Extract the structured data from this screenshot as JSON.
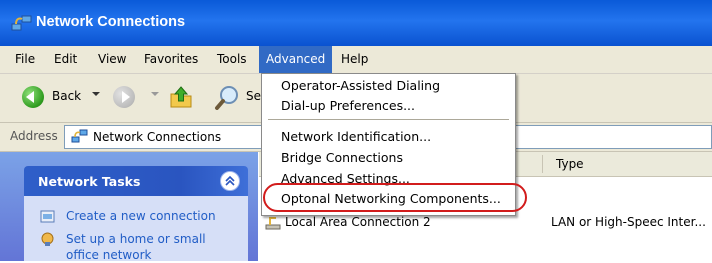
{
  "window": {
    "title": "Network Connections"
  },
  "menu": {
    "file": "File",
    "edit": "Edit",
    "view": "View",
    "favorites": "Favorites",
    "tools": "Tools",
    "advanced": "Advanced",
    "help": "Help"
  },
  "advanced_menu": {
    "items": [
      "Operator-Assisted Dialing",
      "Dial-up Preferences...",
      "Network Identification...",
      "Bridge Connections",
      "Advanced Settings...",
      "Optonal Networking Components..."
    ]
  },
  "toolbar": {
    "back_label": "Back",
    "search_label_partial": "Se"
  },
  "address": {
    "label": "Address",
    "value": "Network Connections"
  },
  "tasks": {
    "header": "Network Tasks",
    "items": [
      "Create a new connection",
      "Set up a home or small office network"
    ]
  },
  "list": {
    "type_header": "Type",
    "rows": [
      {
        "name": "Local Area Connection 2",
        "type": "LAN or High-Speec Inter..."
      }
    ]
  },
  "colors": {
    "title_bar": "#0a5ad8",
    "menu_active": "#316ac5",
    "link": "#215dc6",
    "highlight_oval": "#d21c1c"
  }
}
